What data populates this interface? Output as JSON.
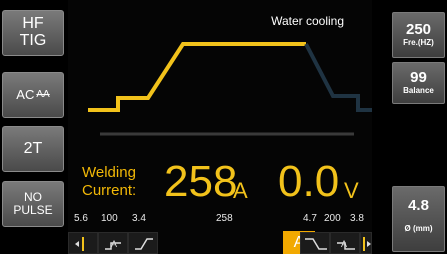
{
  "left_panel": {
    "mode_top": "HF",
    "mode_bottom": "TIG",
    "ac_label": "AC",
    "ac_wave": "AA",
    "trigger": "2T",
    "pulse_top": "NO",
    "pulse_bottom": "PULSE"
  },
  "screen": {
    "water_cooling": "Water cooling",
    "welding_label_1": "Welding",
    "welding_label_2": "Current:",
    "current_value": "258",
    "current_unit": "A",
    "voltage_value": "0.0",
    "voltage_unit": "V",
    "params_left": [
      "5.6",
      "100",
      "3.4"
    ],
    "param_center": "258",
    "params_right": [
      "4.7",
      "200",
      "3.8"
    ],
    "a_button": "A"
  },
  "right_panel": {
    "freq_value": "250",
    "freq_label": "Fre.(HZ)",
    "balance_value": "99",
    "balance_label": "Balance",
    "electrode_value": "4.8",
    "electrode_label": "Ø (mm)"
  },
  "colors": {
    "accent": "#f2c21b",
    "accent_orange": "#f2a900",
    "background": "#050505",
    "button_gray": "#5a5a5a"
  }
}
